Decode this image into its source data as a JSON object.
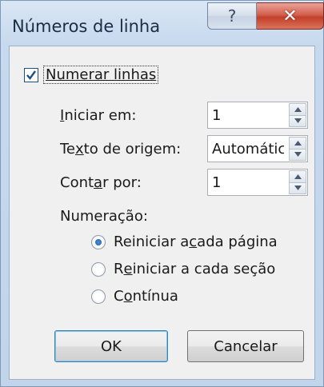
{
  "window": {
    "title": "Números de linha"
  },
  "caption": {
    "help_glyph": "?",
    "close_glyph": "✕"
  },
  "numerar": {
    "label": "Numerar linhas",
    "checked": true
  },
  "fields": [
    {
      "label_pre": "",
      "label_acc": "I",
      "label_post": "niciar em:",
      "value": "1"
    },
    {
      "label_pre": "Te",
      "label_acc": "x",
      "label_post": "to de origem:",
      "value": "Automátic"
    },
    {
      "label_pre": "Cont",
      "label_acc": "a",
      "label_post": "r por:",
      "value": "1"
    }
  ],
  "numeracao": {
    "label": "Numeração:",
    "options": [
      {
        "pre": "Reiniciar a ",
        "acc": "c",
        "post": "ada página",
        "selected": true
      },
      {
        "pre": "R",
        "acc": "e",
        "post": "iniciar a cada seção",
        "selected": false
      },
      {
        "pre": "C",
        "acc": "o",
        "post": "ntínua",
        "selected": false
      }
    ]
  },
  "buttons": {
    "ok": "OK",
    "cancel": "Cancelar"
  },
  "colors": {
    "accent": "#1d5ea8",
    "close": "#c43f2a"
  },
  "icons": {
    "help": "help-icon",
    "close": "close-icon",
    "check": "checkmark-icon",
    "spin_up": "arrow-up-icon",
    "spin_down": "arrow-down-icon"
  }
}
